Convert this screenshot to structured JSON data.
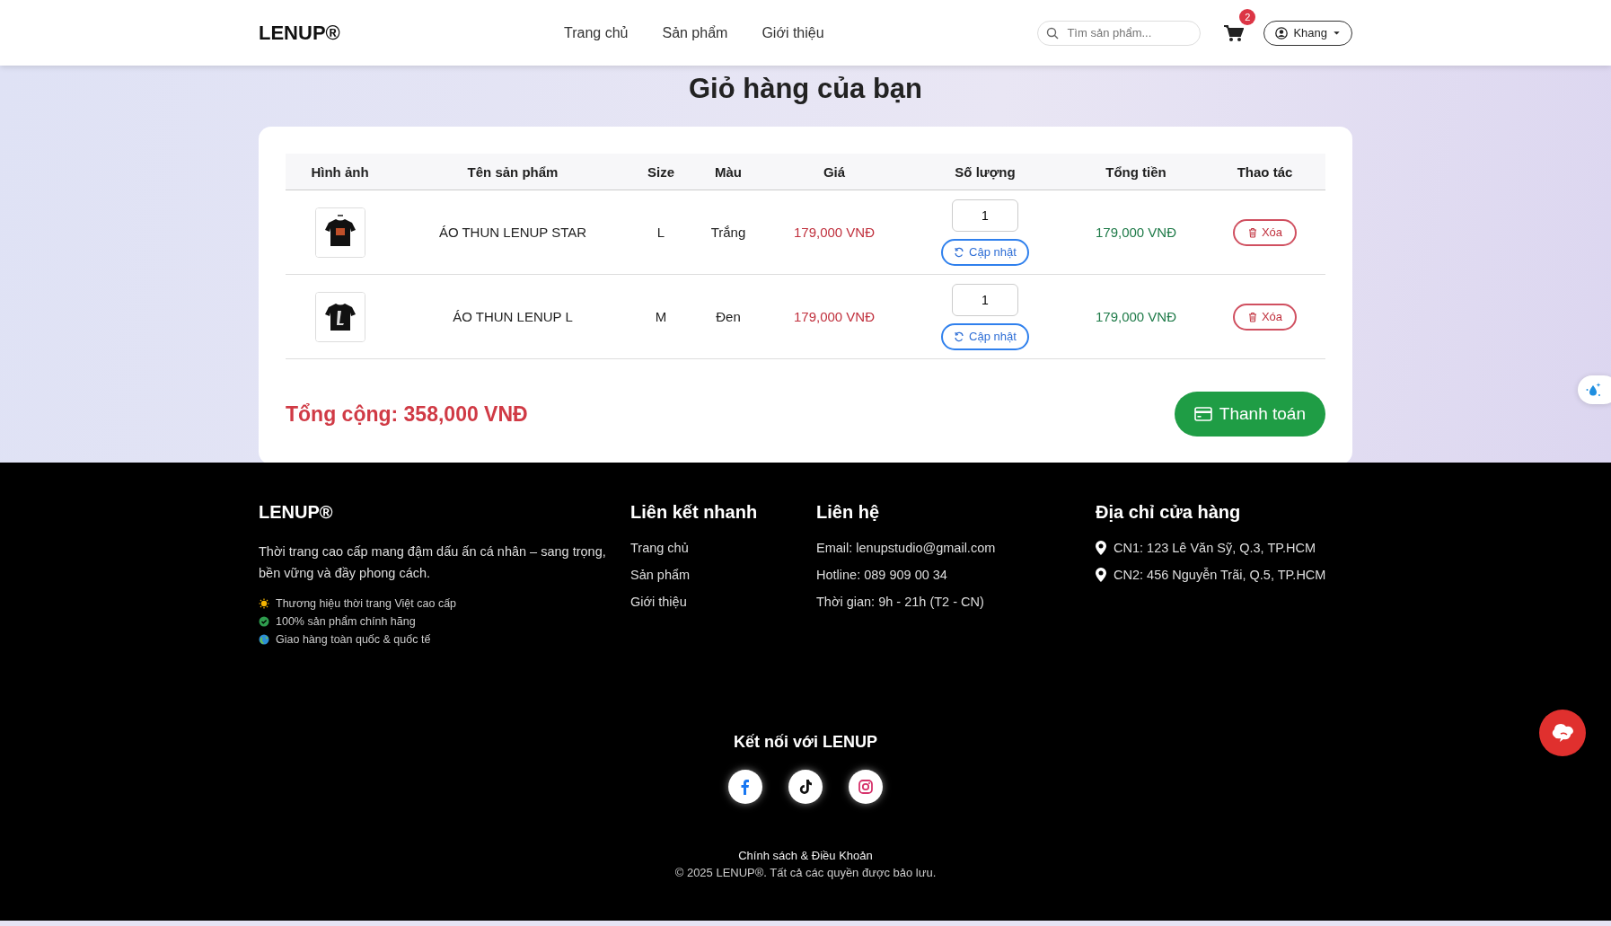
{
  "header": {
    "logo": "LENUP®",
    "nav": [
      {
        "label": "Trang chủ"
      },
      {
        "label": "Sản phẩm"
      },
      {
        "label": "Giới thiệu"
      }
    ],
    "search": {
      "placeholder": "Tìm sản phẩm..."
    },
    "cart_count": "2",
    "user": "Khang"
  },
  "page_title": "Giỏ hàng của bạn",
  "table": {
    "columns": [
      "Hình ảnh",
      "Tên sản phẩm",
      "Size",
      "Màu",
      "Giá",
      "Số lượng",
      "Tổng tiền",
      "Thao tác"
    ],
    "rows": [
      {
        "name": "ÁO THUN LENUP STAR",
        "size": "L",
        "color_name": "Trắng",
        "price": "179,000 VNĐ",
        "quantity": "1",
        "update": "Cập nhật",
        "total": "179,000 VNĐ",
        "delete": "Xóa"
      },
      {
        "name": "ÁO THUN LENUP L",
        "size": "M",
        "color_name": "Đen",
        "price": "179,000 VNĐ",
        "quantity": "1",
        "update": "Cập nhật",
        "total": "179,000 VNĐ",
        "delete": "Xóa"
      }
    ]
  },
  "grand_total": "Tổng cộng: 358,000 VNĐ",
  "checkout": "Thanh toán",
  "footer": {
    "brand": "LENUP®",
    "description": "Thời trang cao cấp mang đậm dấu ấn cá nhân – sang trọng, bền vững và đầy phong cách.",
    "features": [
      {
        "kind": "sun",
        "text": "Thương hiệu thời trang Việt cao cấp"
      },
      {
        "kind": "check",
        "text": "100% sản phẩm chính hãng"
      },
      {
        "kind": "globe",
        "text": "Giao hàng toàn quốc & quốc tế"
      }
    ],
    "quick_links": {
      "title": "Liên kết nhanh",
      "items": [
        "Trang chủ",
        "Sản phẩm",
        "Giới thiệu"
      ]
    },
    "contact": {
      "title": "Liên hệ",
      "items": [
        "Email: lenupstudio@gmail.com",
        "Hotline: 089 909 00 34",
        "Thời gian: 9h - 21h (T2 - CN)"
      ]
    },
    "stores": {
      "title": "Địa chỉ cửa hàng",
      "items": [
        "CN1: 123 Lê Văn Sỹ, Q.3, TP.HCM",
        "CN2: 456 Nguyễn Trãi, Q.5, TP.HCM"
      ]
    },
    "connect_title": "Kết nối với LENUP",
    "policy": "Chính sách & Điều Khoản",
    "copyright": "© 2025 LENUP®. Tất cả các quyền được bảo lưu."
  }
}
